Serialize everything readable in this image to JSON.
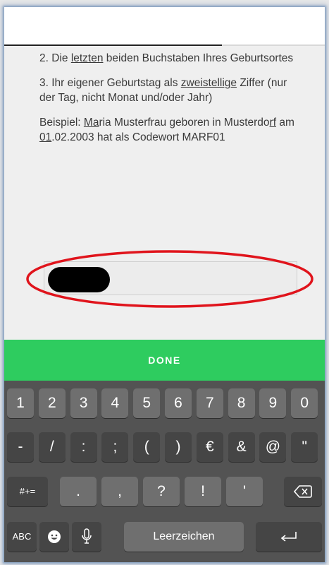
{
  "instructions": {
    "item2": [
      "2. Die ",
      "letzten",
      " beiden Buchstaben Ihres Geburtsortes"
    ],
    "item3": [
      "3. Ihr eigener Geburtstag als ",
      "zweistellige",
      " Ziffer (nur der Tag, nicht Monat und/oder Jahr)"
    ],
    "example": [
      "Beispiel: ",
      "Ma",
      "ria Musterfrau geboren in Musterdo",
      "rf",
      " am ",
      "01",
      ".02.2003 hat als Codewort MARF01"
    ]
  },
  "progress": 0.68,
  "done_label": "DONE",
  "keyboard": {
    "row1": [
      "1",
      "2",
      "3",
      "4",
      "5",
      "6",
      "7",
      "8",
      "9",
      "0"
    ],
    "row2": [
      "-",
      "/",
      ":",
      ";",
      "(",
      ")",
      "€",
      "&",
      "@",
      "\""
    ],
    "row3_left": "#+=",
    "row3": [
      ".",
      ",",
      "?",
      "!",
      "'"
    ],
    "row4": {
      "abc": "ABC",
      "space": "Leerzeichen"
    }
  },
  "colors": {
    "done_bar": "#2ecc5f",
    "highlight_ellipse": "#e0141c",
    "keyboard_bg": "#535353"
  }
}
